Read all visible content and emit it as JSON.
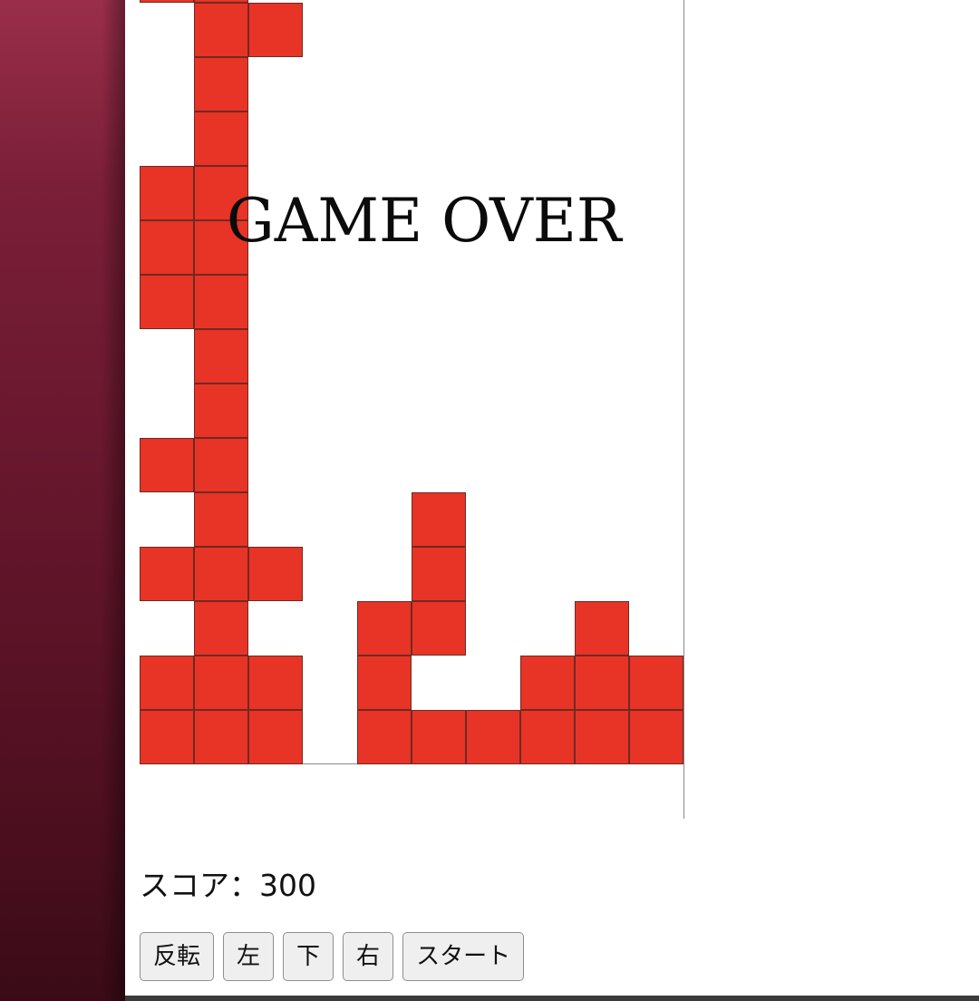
{
  "game": {
    "board": {
      "columns": 10,
      "cell_color": "#e73426",
      "filled_cells": [
        [
          0,
          0
        ],
        [
          1,
          0
        ],
        [
          1,
          1
        ],
        [
          2,
          1
        ],
        [
          1,
          2
        ],
        [
          1,
          3
        ],
        [
          0,
          4
        ],
        [
          1,
          4
        ],
        [
          0,
          5
        ],
        [
          1,
          5
        ],
        [
          0,
          6
        ],
        [
          1,
          6
        ],
        [
          1,
          7
        ],
        [
          1,
          8
        ],
        [
          0,
          9
        ],
        [
          1,
          9
        ],
        [
          1,
          10
        ],
        [
          5,
          10
        ],
        [
          0,
          11
        ],
        [
          1,
          11
        ],
        [
          2,
          11
        ],
        [
          5,
          11
        ],
        [
          1,
          12
        ],
        [
          4,
          12
        ],
        [
          5,
          12
        ],
        [
          8,
          12
        ],
        [
          0,
          13
        ],
        [
          1,
          13
        ],
        [
          2,
          13
        ],
        [
          4,
          13
        ],
        [
          7,
          13
        ],
        [
          8,
          13
        ],
        [
          9,
          13
        ],
        [
          0,
          14
        ],
        [
          1,
          14
        ],
        [
          2,
          14
        ],
        [
          4,
          14
        ],
        [
          5,
          14
        ],
        [
          6,
          14
        ],
        [
          7,
          14
        ],
        [
          8,
          14
        ],
        [
          9,
          14
        ]
      ]
    },
    "overlay_text": "GAME OVER",
    "score": {
      "label": "スコア：",
      "value": "300"
    },
    "controls": {
      "rotate": "反転",
      "left": "左",
      "down": "下",
      "right": "右",
      "start": "スタート"
    }
  }
}
